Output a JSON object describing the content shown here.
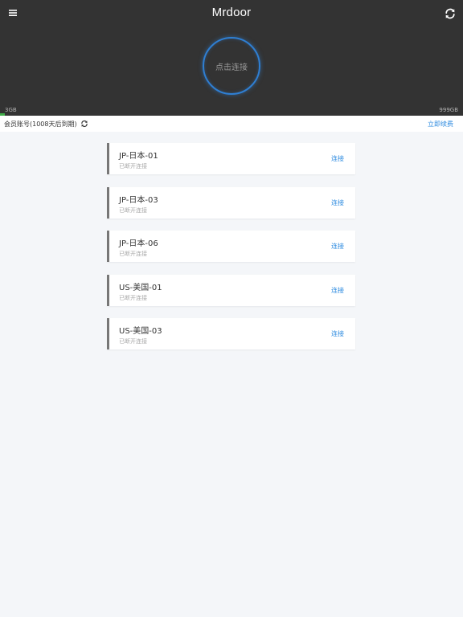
{
  "header": {
    "title": "Mrdoor",
    "menu_icon": "menu-icon",
    "refresh_icon": "refresh-icon",
    "connect_button_label": "点击连接",
    "ring_color": "#2f7fd3",
    "background_color": "#333333"
  },
  "traffic": {
    "used_label": "3GB",
    "total_label": "999GB",
    "used_fraction": 0.003,
    "fill_color": "#3fae49"
  },
  "account": {
    "label": "会员账号(1008天后到期)",
    "refresh_icon": "refresh-icon",
    "renew_label": "立即续费"
  },
  "servers": [
    {
      "name": "JP-日本-01",
      "status": "已断开连接",
      "action": "连接"
    },
    {
      "name": "JP-日本-03",
      "status": "已断开连接",
      "action": "连接"
    },
    {
      "name": "JP-日本-06",
      "status": "已断开连接",
      "action": "连接"
    },
    {
      "name": "US-美国-01",
      "status": "已断开连接",
      "action": "连接"
    },
    {
      "name": "US-美国-03",
      "status": "已断开连接",
      "action": "连接"
    }
  ],
  "colors": {
    "accent": "#2e8be0",
    "card_marker": "#777777",
    "page_background": "#f4f6f9"
  }
}
